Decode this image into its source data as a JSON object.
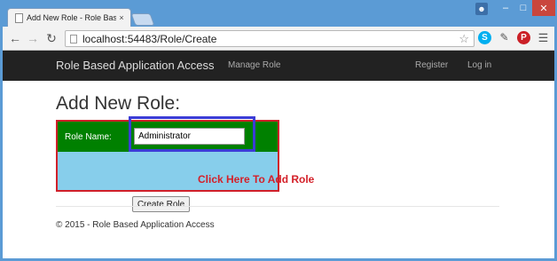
{
  "browser": {
    "tab_title": "Add New Role - Role Base",
    "tab_close": "×",
    "url_host": "localhost",
    "url_rest": ":54483/Role/Create"
  },
  "colors": {
    "frame": "#5b9bd5",
    "navbar": "#222222",
    "green_row": "#008000",
    "blue_row": "#87ceeb",
    "highlight_red": "#d0202a",
    "highlight_blue": "#3c3cd6",
    "callout_red": "#d42029"
  },
  "icons": {
    "back": "arrow-left-icon",
    "forward": "arrow-right-icon",
    "reload": "reload-icon",
    "star": "star-icon",
    "skype": "skype-icon",
    "dropper": "eyedropper-icon",
    "pinterest": "pinterest-icon",
    "menu": "hamburger-menu-icon"
  },
  "navbar": {
    "brand": "Role Based Application Access",
    "manage": "Manage Role",
    "register": "Register",
    "login": "Log in"
  },
  "page": {
    "heading": "Add New Role:",
    "role_label": "Role Name:",
    "role_value": "Administrator",
    "create_button": "Create Role",
    "callout": "Click Here To Add Role",
    "footer": "© 2015 - Role Based Application Access"
  }
}
